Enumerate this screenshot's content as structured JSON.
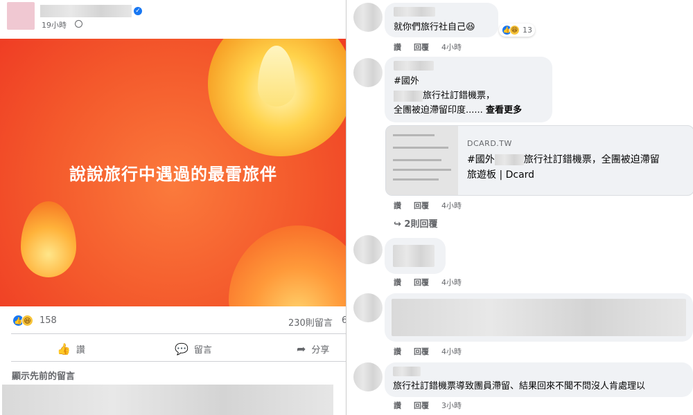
{
  "post": {
    "time": "19小時",
    "banner_title": "說說旅行中遇過的最雷旅伴",
    "reaction_count": "158",
    "comment_count": "230則留言",
    "share_count_partial": "6",
    "actions": {
      "like": "讚",
      "comment": "留言",
      "share": "分享"
    },
    "show_previous": "顯示先前的留言"
  },
  "comments": [
    {
      "text": "就你們旅行社自己",
      "emoji": "😆",
      "reactions": "13",
      "action_like": "讚",
      "action_reply": "回覆",
      "time": "4小時"
    },
    {
      "tag": "#國外",
      "line1": "旅行社訂錯機票，",
      "line2": "全團被迫滯留印度......",
      "see_more": "查看更多",
      "action_like": "讚",
      "action_reply": "回覆",
      "time": "4小時"
    },
    {
      "action_like": "讚",
      "action_reply": "回覆",
      "time": "4小時"
    },
    {
      "action_like": "讚",
      "action_reply": "回覆",
      "time": "4小時"
    },
    {
      "text": "旅行社訂錯機票導致團員滯留、結果回來不聞不問沒人肯處理以",
      "action_like": "讚",
      "action_reply": "回覆",
      "time": "3小時"
    }
  ],
  "link_card": {
    "domain": "DCARD.TW",
    "title_prefix": "#國外",
    "title_rest": "旅行社訂錯機票，全團被迫滯留",
    "title_line2": "旅遊板 | Dcard"
  },
  "replies_label": "↪ 2則回覆"
}
